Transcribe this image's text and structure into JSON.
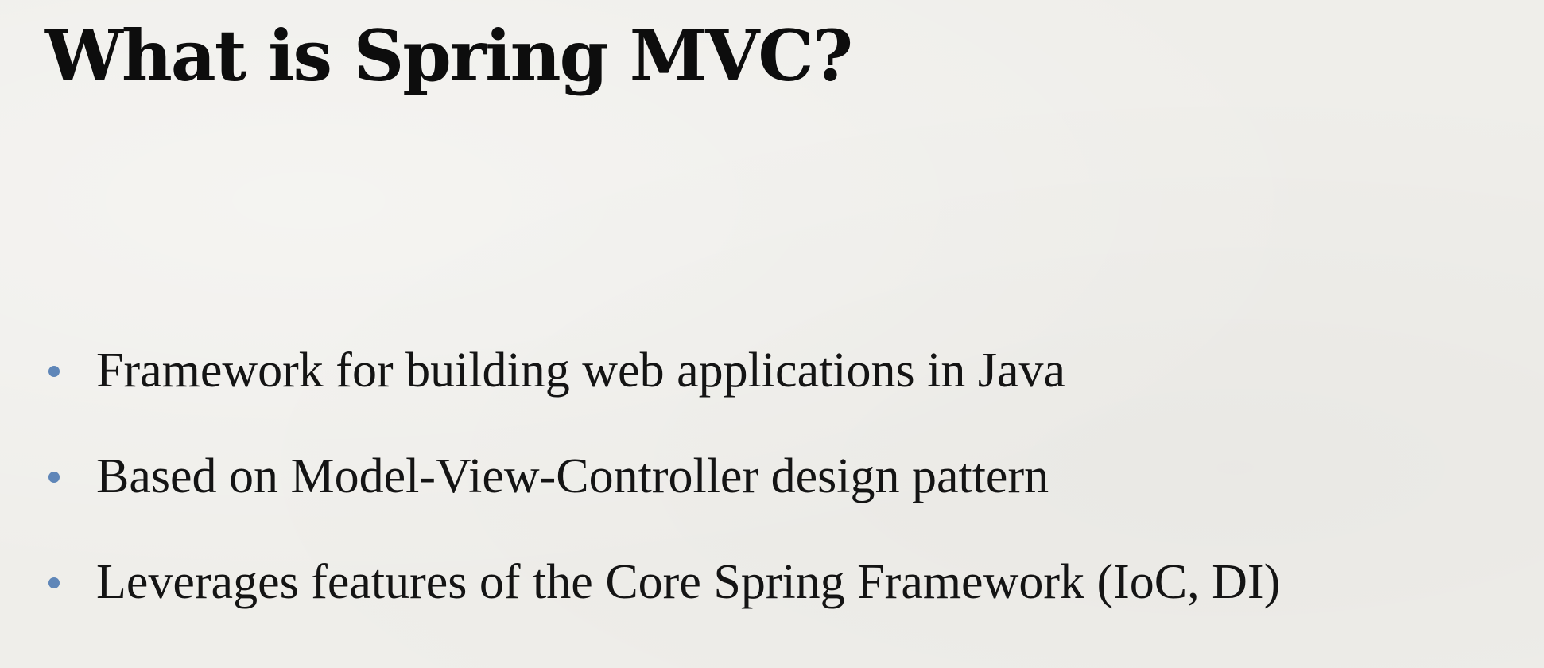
{
  "slide": {
    "title": "What is Spring MVC?",
    "bullets": [
      {
        "text": "Framework for building web applications in Java"
      },
      {
        "text": "Based on Model-View-Controller design pattern"
      },
      {
        "text": "Leverages features of the Core Spring Framework (IoC, DI)"
      }
    ]
  },
  "colors": {
    "background": "#efeeea",
    "title": "#0d0d0d",
    "text": "#141414",
    "bullet": "#5f86b8"
  }
}
